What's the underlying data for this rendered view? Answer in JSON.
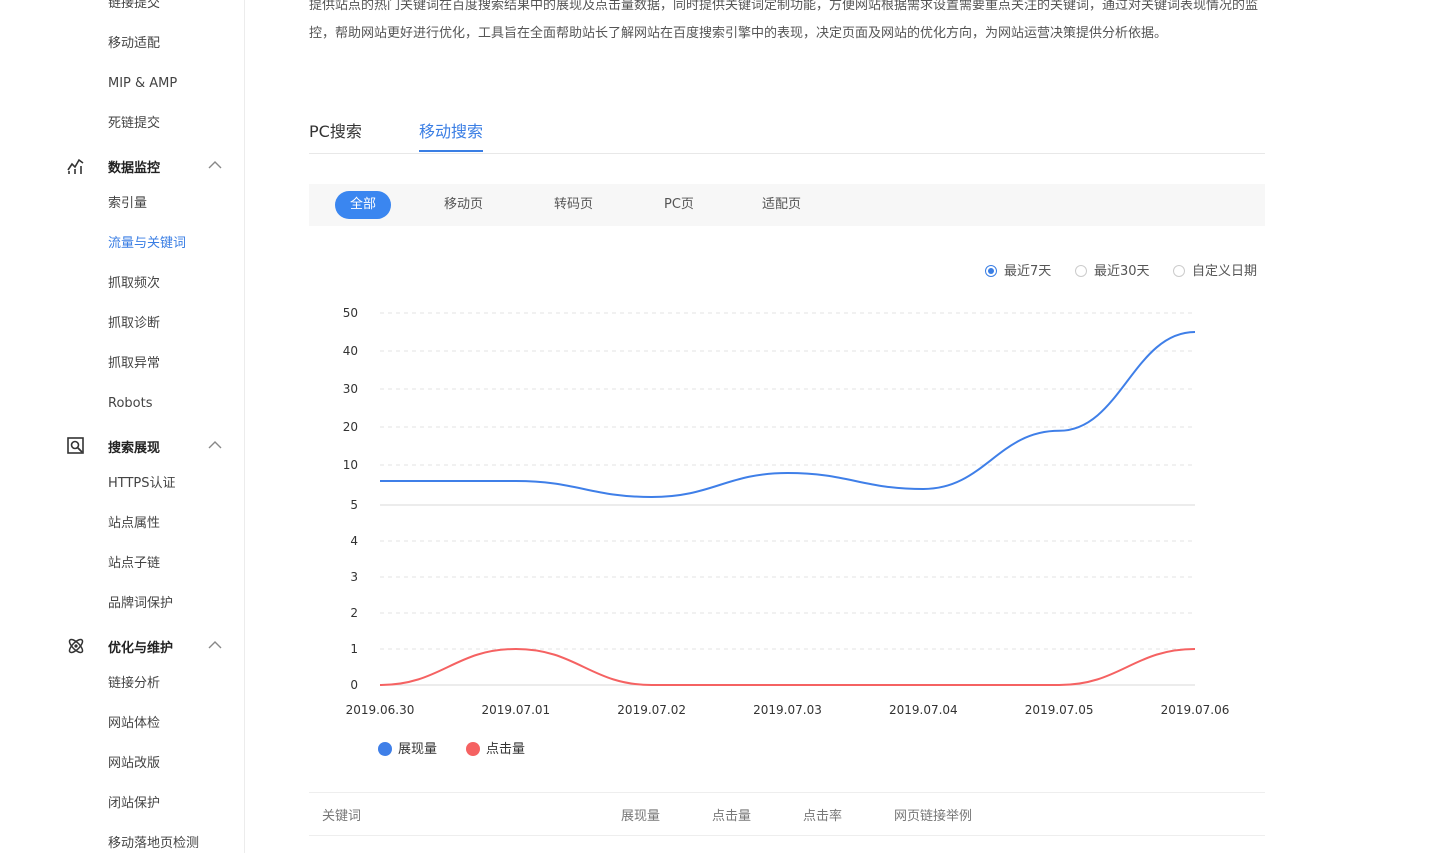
{
  "sidebar": {
    "top_items": [
      "链接提交",
      "移动适配",
      "MIP & AMP",
      "死链提交"
    ],
    "groups": [
      {
        "label": "数据监控",
        "icon": "chart-icon",
        "items": [
          "索引量",
          "流量与关键词",
          "抓取频次",
          "抓取诊断",
          "抓取异常",
          "Robots"
        ],
        "active": "流量与关键词"
      },
      {
        "label": "搜索展现",
        "icon": "search-display-icon",
        "items": [
          "HTTPS认证",
          "站点属性",
          "站点子链",
          "品牌词保护"
        ]
      },
      {
        "label": "优化与维护",
        "icon": "atom-icon",
        "items": [
          "链接分析",
          "网站体检",
          "网站改版",
          "闭站保护",
          "移动落地页检测"
        ]
      }
    ]
  },
  "intro": {
    "text": "提供站点的热门关键词在百度搜索结果中的展现及点击量数据，同时提供关键词定制功能，方便网站根据需求设置需要重点关注的关键词，通过对关键词表现情况的监控，帮助网站更好进行优化，工具旨在全面帮助站长了解网站在百度搜索引擎中的表现，决定页面及网站的优化方向，为网站运营决策提供分析依据。"
  },
  "tabs": [
    {
      "label": "PC搜索",
      "active": false
    },
    {
      "label": "移动搜索",
      "active": true
    }
  ],
  "filters": [
    {
      "label": "全部",
      "active": true
    },
    {
      "label": "移动页",
      "active": false
    },
    {
      "label": "转码页",
      "active": false
    },
    {
      "label": "PC页",
      "active": false
    },
    {
      "label": "适配页",
      "active": false
    }
  ],
  "date_ranges": [
    {
      "label": "最近7天",
      "checked": true
    },
    {
      "label": "最近30天",
      "checked": false
    },
    {
      "label": "自定义日期",
      "checked": false
    }
  ],
  "chart_data": {
    "type": "line",
    "x": [
      "2019.06.30",
      "2019.07.01",
      "2019.07.02",
      "2019.07.03",
      "2019.07.04",
      "2019.07.05",
      "2019.07.06"
    ],
    "y_ticks": [
      0,
      1,
      2,
      3,
      4,
      5,
      10,
      20,
      30,
      40,
      50
    ],
    "ylim": [
      0,
      50
    ],
    "grid": true,
    "legend": "bottom-left",
    "series": [
      {
        "name": "展现量",
        "color": "#3f7fe8",
        "values": [
          8,
          8,
          6,
          9,
          7,
          19,
          45
        ]
      },
      {
        "name": "点击量",
        "color": "#f56262",
        "values": [
          0,
          1,
          0,
          0,
          0,
          0,
          1
        ]
      }
    ]
  },
  "table": {
    "columns": [
      "关键词",
      "展现量",
      "点击量",
      "点击率",
      "网页链接举例"
    ]
  }
}
